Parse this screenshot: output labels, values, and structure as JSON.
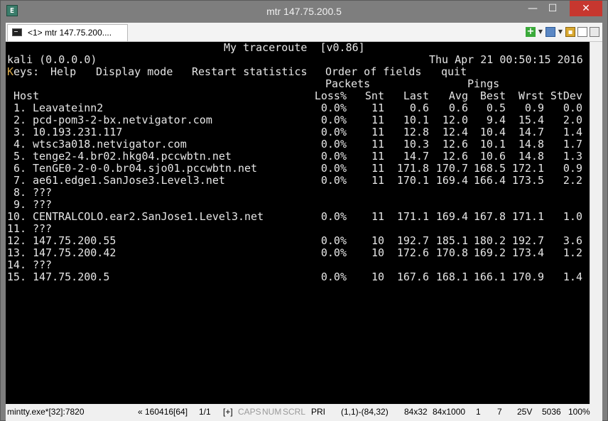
{
  "window": {
    "title": "mtr 147.75.200.5"
  },
  "tab": {
    "label": "<1> mtr 147.75.200...."
  },
  "terminal": {
    "program_title": "My traceroute  [v0.86]",
    "source": "kali (0.0.0.0)",
    "datetime": "Thu Apr 21 00:50:15 2016",
    "keys_first_letter": "K",
    "keys_label": "eys:",
    "keys": [
      "Help",
      "Display mode",
      "Restart statistics",
      "Order of fields",
      "quit"
    ],
    "group_packets": "Packets",
    "group_pings": "Pings",
    "headers": {
      "host": "Host",
      "loss": "Loss%",
      "snt": "Snt",
      "last": "Last",
      "avg": "Avg",
      "best": "Best",
      "wrst": "Wrst",
      "stdev": "StDev"
    },
    "hops": [
      {
        "num": "1.",
        "host": "Leavateinn2",
        "loss": "0.0%",
        "snt": "11",
        "last": "0.6",
        "avg": "0.6",
        "best": "0.5",
        "wrst": "0.9",
        "stdev": "0.0"
      },
      {
        "num": "2.",
        "host": "pcd-pom3-2-bx.netvigator.com",
        "loss": "0.0%",
        "snt": "11",
        "last": "10.1",
        "avg": "12.0",
        "best": "9.4",
        "wrst": "15.4",
        "stdev": "2.0"
      },
      {
        "num": "3.",
        "host": "10.193.231.117",
        "loss": "0.0%",
        "snt": "11",
        "last": "12.8",
        "avg": "12.4",
        "best": "10.4",
        "wrst": "14.7",
        "stdev": "1.4"
      },
      {
        "num": "4.",
        "host": "wtsc3a018.netvigator.com",
        "loss": "0.0%",
        "snt": "11",
        "last": "10.3",
        "avg": "12.6",
        "best": "10.1",
        "wrst": "14.8",
        "stdev": "1.7"
      },
      {
        "num": "5.",
        "host": "tenge2-4.br02.hkg04.pccwbtn.net",
        "loss": "0.0%",
        "snt": "11",
        "last": "14.7",
        "avg": "12.6",
        "best": "10.6",
        "wrst": "14.8",
        "stdev": "1.3"
      },
      {
        "num": "6.",
        "host": "TenGE0-2-0-0.br04.sjo01.pccwbtn.net",
        "loss": "0.0%",
        "snt": "11",
        "last": "171.8",
        "avg": "170.7",
        "best": "168.5",
        "wrst": "172.1",
        "stdev": "0.9"
      },
      {
        "num": "7.",
        "host": "ae61.edge1.SanJose3.Level3.net",
        "loss": "0.0%",
        "snt": "11",
        "last": "170.1",
        "avg": "169.4",
        "best": "166.4",
        "wrst": "173.5",
        "stdev": "2.2"
      },
      {
        "num": "8.",
        "host": "???",
        "loss": "",
        "snt": "",
        "last": "",
        "avg": "",
        "best": "",
        "wrst": "",
        "stdev": ""
      },
      {
        "num": "9.",
        "host": "???",
        "loss": "",
        "snt": "",
        "last": "",
        "avg": "",
        "best": "",
        "wrst": "",
        "stdev": ""
      },
      {
        "num": "10.",
        "host": "CENTRALCOLO.ear2.SanJose1.Level3.net",
        "loss": "0.0%",
        "snt": "11",
        "last": "171.1",
        "avg": "169.4",
        "best": "167.8",
        "wrst": "171.1",
        "stdev": "1.0"
      },
      {
        "num": "11.",
        "host": "???",
        "loss": "",
        "snt": "",
        "last": "",
        "avg": "",
        "best": "",
        "wrst": "",
        "stdev": ""
      },
      {
        "num": "12.",
        "host": "147.75.200.55",
        "loss": "0.0%",
        "snt": "10",
        "last": "192.7",
        "avg": "185.1",
        "best": "180.2",
        "wrst": "192.7",
        "stdev": "3.6"
      },
      {
        "num": "13.",
        "host": "147.75.200.42",
        "loss": "0.0%",
        "snt": "10",
        "last": "172.6",
        "avg": "170.8",
        "best": "169.2",
        "wrst": "173.4",
        "stdev": "1.2"
      },
      {
        "num": "14.",
        "host": "???",
        "loss": "",
        "snt": "",
        "last": "",
        "avg": "",
        "best": "",
        "wrst": "",
        "stdev": ""
      },
      {
        "num": "15.",
        "host": "147.75.200.5",
        "loss": "0.0%",
        "snt": "10",
        "last": "167.6",
        "avg": "168.1",
        "best": "166.1",
        "wrst": "170.9",
        "stdev": "1.4"
      }
    ]
  },
  "statusbar": {
    "process": "mintty.exe*[32]:7820",
    "buffer": "« 160416[64]",
    "page": "1/1",
    "plus": "[+]",
    "caps": "CAPS",
    "num": "NUM",
    "scrl": "SCRL",
    "pri": "PRI",
    "cursor": "(1,1)-(84,32)",
    "size": "84x32",
    "buffer_size": "84x1000",
    "v1": "1",
    "v2": "7",
    "voltage": "25V",
    "pid": "5036",
    "zoom": "100%"
  },
  "colors": {
    "terminal_bg": "#000000",
    "terminal_fg": "#e6e6e6",
    "keys_highlight": "#d7a84a",
    "close_button": "#c7372f",
    "titlebar": "#7e7e7e"
  },
  "icons": [
    "console-app-icon",
    "minimize-icon",
    "maximize-icon",
    "close-icon",
    "new-console-icon",
    "window-icon",
    "lock-icon",
    "page-icon",
    "columns-icon"
  ]
}
